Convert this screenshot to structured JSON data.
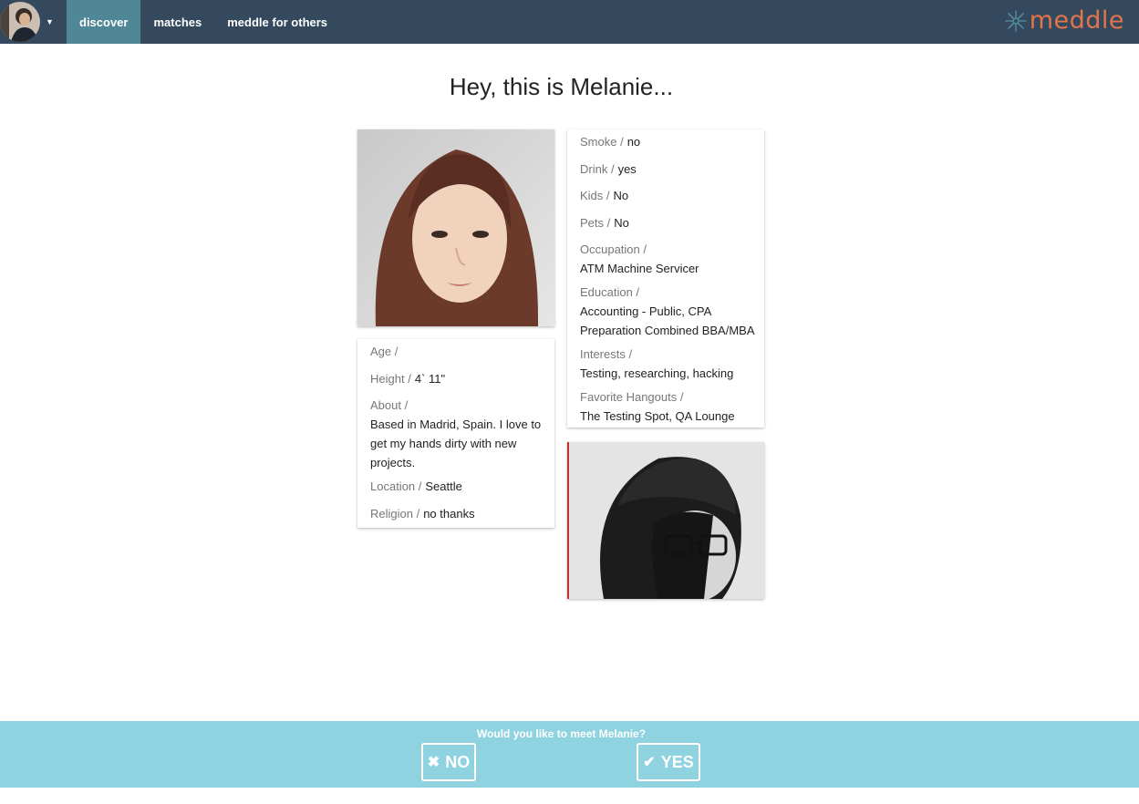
{
  "nav": {
    "items": [
      {
        "label": "discover"
      },
      {
        "label": "matches"
      },
      {
        "label": "meddle for others"
      }
    ],
    "logo_text": "meddle",
    "accent": "#e2744a",
    "bar_color": "#34495e",
    "active_color": "#4f8796"
  },
  "profile": {
    "title": "Hey, this is Melanie...",
    "left": {
      "age_label": "Age /",
      "age_value": "",
      "height_label": "Height /",
      "height_value": "4` 11\"",
      "about_label": "About /",
      "about_value": "Based in Madrid, Spain. I love to get my hands dirty with new projects.",
      "location_label": "Location /",
      "location_value": "Seattle",
      "religion_label": "Religion /",
      "religion_value": "no thanks"
    },
    "right": {
      "smoke_label": "Smoke /",
      "smoke_value": "no",
      "drink_label": "Drink /",
      "drink_value": "yes",
      "kids_label": "Kids /",
      "kids_value": "No",
      "pets_label": "Pets /",
      "pets_value": "No",
      "occupation_label": "Occupation /",
      "occupation_value": "ATM Machine Servicer",
      "education_label": "Education /",
      "education_value": "Accounting - Public, CPA Preparation Combined BBA/MBA",
      "interests_label": "Interests /",
      "interests_value": "Testing, researching, hacking",
      "hangouts_label": "Favorite Hangouts /",
      "hangouts_value": "The Testing Spot, QA Lounge"
    }
  },
  "decision": {
    "prompt": "Would you like to meet Melanie?",
    "no_label": "NO",
    "yes_label": "YES",
    "no_icon": "x-icon",
    "yes_icon": "check-icon",
    "bar_color": "#8fd3e0"
  }
}
